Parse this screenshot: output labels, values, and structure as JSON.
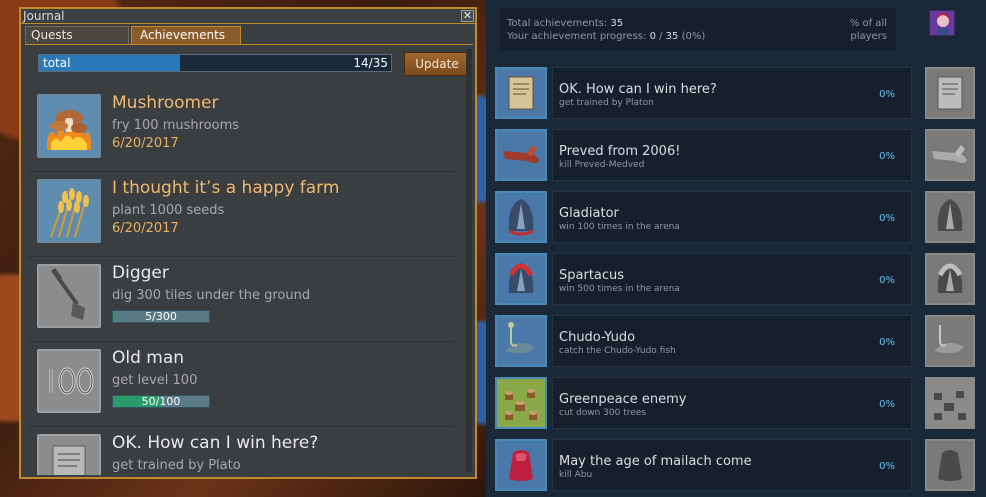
{
  "journal": {
    "title": "Journal",
    "close_glyph": "✕",
    "tabs": [
      {
        "label": "Quests",
        "active": false
      },
      {
        "label": "Achievements",
        "active": true
      }
    ],
    "total": {
      "label": "total",
      "count_text": "14/35",
      "progress_fraction": 0.4
    },
    "update_label": "Update",
    "items": [
      {
        "name": "Mushroomer",
        "desc": "fry 100 mushrooms",
        "date": "6/20/2017",
        "icon": "fried-mushrooms-icon",
        "completed": true
      },
      {
        "name": "I thought it’s a happy farm",
        "desc": "plant 1000 seeds",
        "date": "6/20/2017",
        "icon": "wheat-icon",
        "completed": true
      },
      {
        "name": "Digger",
        "desc": "dig 300 tiles under the ground",
        "progress_text": "5/300",
        "progress_fraction": 0.017,
        "icon": "shovel-icon",
        "completed": false
      },
      {
        "name": "Old man",
        "desc": "get level 100",
        "progress_text": "50/100",
        "progress_fraction": 0.5,
        "icon": "level-100-icon",
        "completed": false
      },
      {
        "name": "OK. How can I win here?",
        "desc": "get trained by Plato",
        "icon": "scroll-icon",
        "completed": false
      }
    ]
  },
  "steam": {
    "summary": {
      "total_label": "Total achievements:",
      "total_value": "35",
      "progress_label": "Your achievement progress:",
      "progress_value": "0",
      "progress_sep": " / ",
      "progress_total": "35",
      "progress_pct": "(0%)",
      "pct_header": "% of all players"
    },
    "achievements": [
      {
        "name": "OK. How can I win here?",
        "desc": "get trained by Platon",
        "pct": "0%",
        "icon": "scroll-icon"
      },
      {
        "name": "Preved from 2006!",
        "desc": "kill Preved-Medved",
        "pct": "0%",
        "icon": "bear-paw-icon"
      },
      {
        "name": "Gladiator",
        "desc": "win 100 times in the arena",
        "pct": "0%",
        "icon": "gladiator-helmet-icon"
      },
      {
        "name": "Spartacus",
        "desc": "win 500 times in the arena",
        "pct": "0%",
        "icon": "spartan-helmet-icon"
      },
      {
        "name": "Chudo-Yudo",
        "desc": "catch the Chudo-Yudo fish",
        "pct": "0%",
        "icon": "fish-hook-icon"
      },
      {
        "name": "Greenpeace enemy",
        "desc": "cut down 300 trees",
        "pct": "0%",
        "icon": "tree-stumps-icon"
      },
      {
        "name": "May the age of mailach come",
        "desc": "kill Abu",
        "pct": "0%",
        "icon": "red-blob-icon"
      }
    ]
  },
  "colors": {
    "journal_border": "#c4882d",
    "completed_name": "#f0b870",
    "steam_bg": "#1b2838",
    "steam_pct": "#66c0f4"
  }
}
